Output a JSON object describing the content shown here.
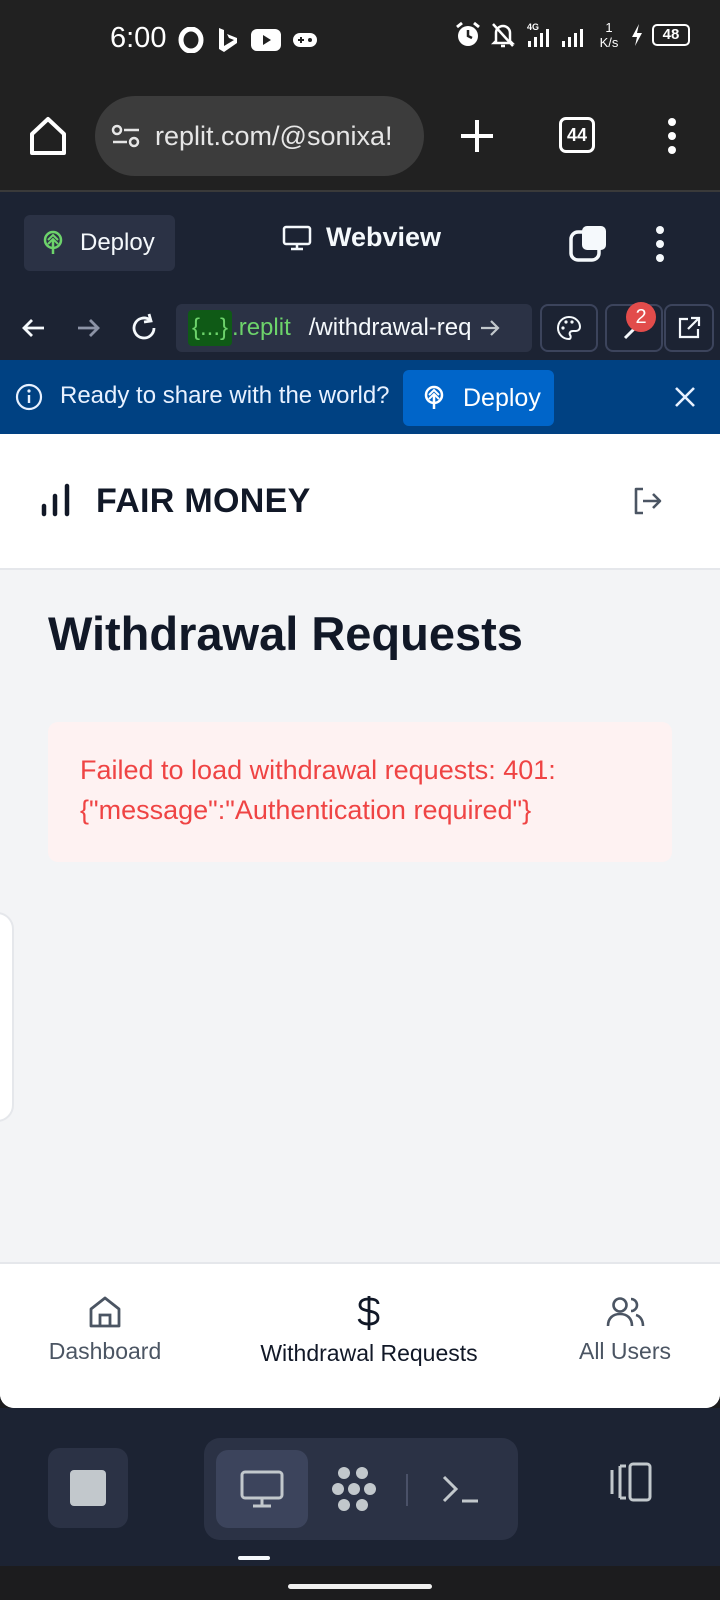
{
  "status_bar": {
    "time": "6:00",
    "net_speed_value": "1",
    "net_speed_unit": "K/s",
    "network_type": "4G",
    "battery": "48"
  },
  "browser": {
    "url": "replit.com/@sonixa!",
    "tab_count": "44"
  },
  "replit_header": {
    "deploy_label": "Deploy",
    "title": "Webview"
  },
  "webview_nav": {
    "address_chip": "{...}",
    "address_domain": ".replit",
    "address_path": "/withdrawal-req",
    "badge_count": "2"
  },
  "banner": {
    "text": "Ready to share with the world?",
    "deploy_label": "Deploy"
  },
  "app": {
    "brand": "FAIR MONEY",
    "page_title": "Withdrawal Requests",
    "error_message": "Failed to load withdrawal requests: 401: {\"message\":\"Authentication required\"}",
    "bottom_nav": {
      "dashboard": "Dashboard",
      "withdrawals": "Withdrawal Requests",
      "users": "All Users"
    }
  },
  "colors": {
    "replit_bg": "#1c2333",
    "banner_bg": "#004182",
    "error_text": "#ef4444",
    "error_bg": "#fef2f2"
  }
}
